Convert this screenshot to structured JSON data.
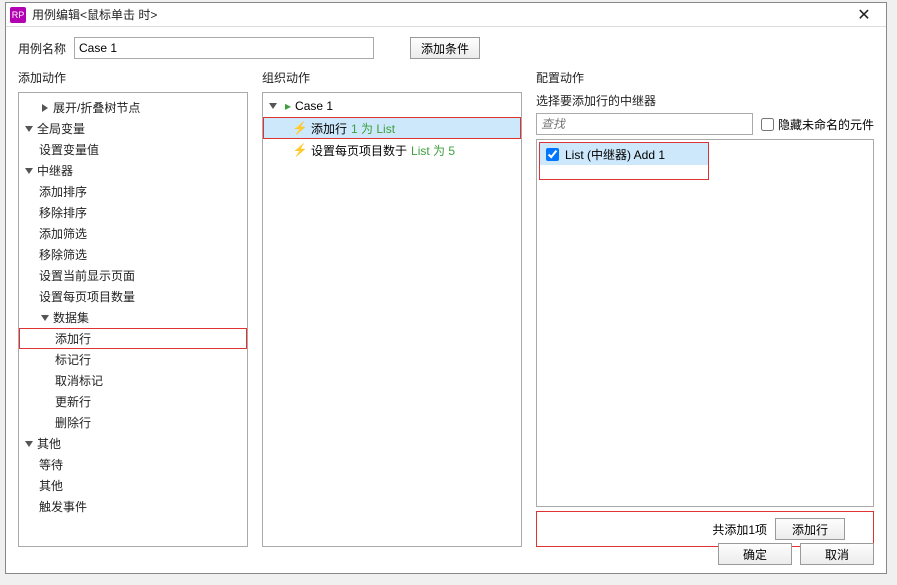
{
  "titlebar": {
    "title": "用例编辑<鼠标单击 时>",
    "icon": "RP"
  },
  "form": {
    "name_label": "用例名称",
    "name_value": "Case 1",
    "add_condition": "添加条件"
  },
  "columns": {
    "left_header": "添加动作",
    "mid_header": "组织动作",
    "right_header": "配置动作"
  },
  "tree": {
    "expand_collapse": "展开/折叠树节点",
    "global_var": "全局变量",
    "set_var": "设置变量值",
    "repeater": "中继器",
    "add_sort": "添加排序",
    "remove_sort": "移除排序",
    "add_filter": "添加筛选",
    "remove_filter": "移除筛选",
    "set_current_page": "设置当前显示页面",
    "set_items_per_page": "设置每页项目数量",
    "dataset": "数据集",
    "add_row": "添加行",
    "mark_row": "标记行",
    "unmark": "取消标记",
    "update_row": "更新行",
    "delete_row": "删除行",
    "other": "其他",
    "wait": "等待",
    "other2": "其他",
    "trigger_event": "触发事件"
  },
  "org": {
    "case_label": "Case 1",
    "row1_a": "添加行",
    "row1_b": "1 为 List",
    "row2_a": "设置每页项目数于",
    "row2_b": "List 为 5"
  },
  "config": {
    "sub_label": "选择要添加行的中继器",
    "search_placeholder": "查找",
    "hide_unnamed": "隐藏未命名的元件",
    "item_label": "List (中继器) Add 1",
    "summary": "共添加1项",
    "add_row_btn": "添加行"
  },
  "footer": {
    "ok": "确定",
    "cancel": "取消"
  }
}
